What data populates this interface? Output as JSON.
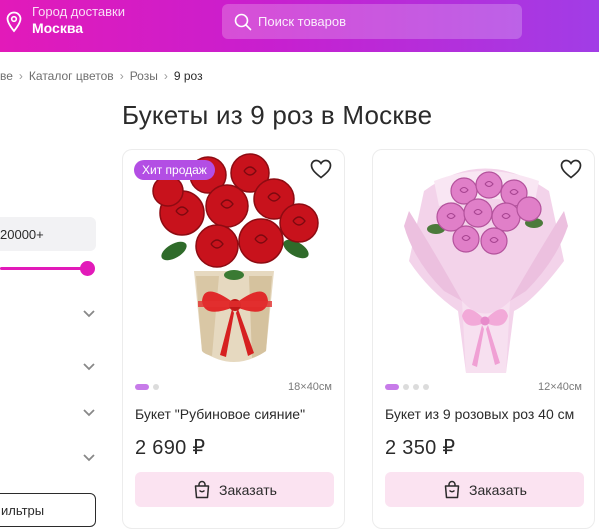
{
  "header": {
    "city_label": "Город доставки",
    "city_value": "Москва",
    "search_placeholder": "Поиск товаров",
    "colors": {
      "gradient_start": "#e21ab9",
      "gradient_end": "#a13de6"
    },
    "icons": {
      "location": "location-pin-icon",
      "search": "search-icon"
    }
  },
  "breadcrumb": [
    "ве",
    "Каталог цветов",
    "Розы",
    "9 роз"
  ],
  "page_title": "Букеты из 9 роз в Москве",
  "filters": {
    "price_max_value": "20000+",
    "price_slider_level": 1.0,
    "filters_button_label": "ильтры",
    "accent": "#e21ab9"
  },
  "products": [
    {
      "badge": "Хит продаж",
      "size": "18×40см",
      "name": "Букет \"Рубиновое сияние\"",
      "price": "2 690 ₽",
      "order_label": "Заказать",
      "photos_count": 2,
      "active_photo": 1
    },
    {
      "badge": "",
      "size": "12×40см",
      "name": "Букет из 9 розовых роз 40 см",
      "price": "2 350 ₽",
      "order_label": "Заказать",
      "photos_count": 4,
      "active_photo": 1
    }
  ]
}
